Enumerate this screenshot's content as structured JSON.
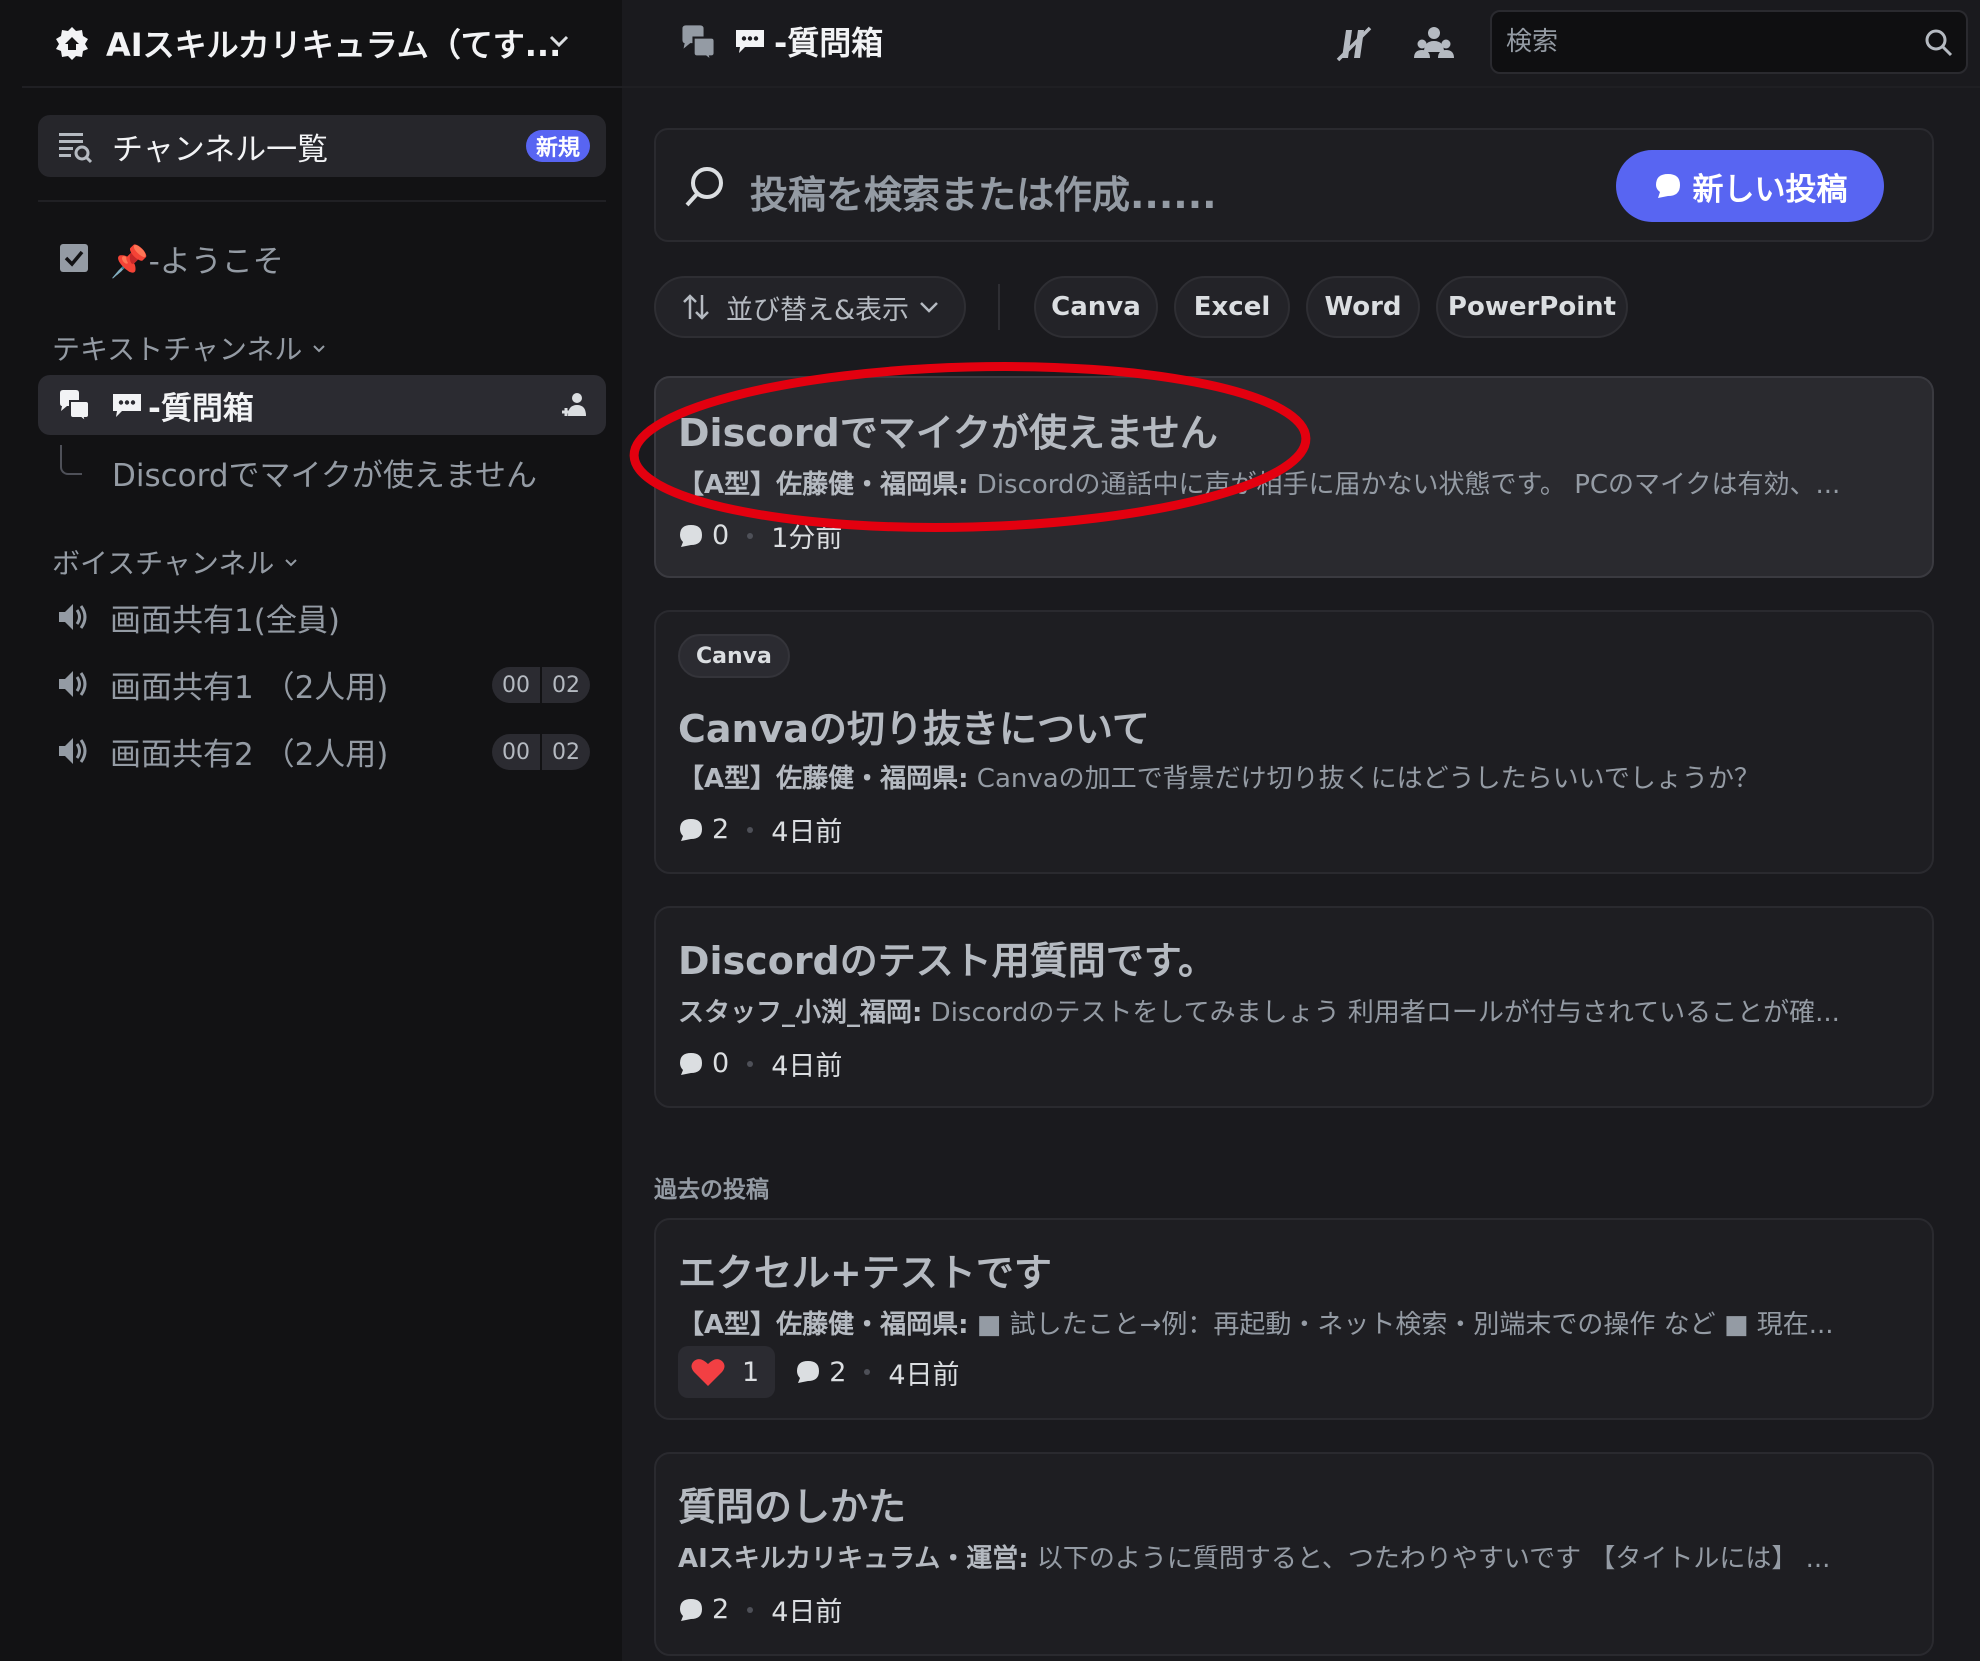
{
  "sidebar": {
    "server_name": "AIスキルカリキュラム（てす...",
    "channel_list": {
      "label": "チャンネル一覧",
      "badge": "新規"
    },
    "welcome": "📌-ようこそ",
    "text_category": "テキストチャンネル",
    "active_channel": "-質問箱",
    "thread": "Discordでマイクが使えません",
    "voice_category": "ボイスチャンネル",
    "voice_channels": [
      {
        "label": "画面共有1(全員)"
      },
      {
        "label": "画面共有1 （2人用)",
        "count_a": "00",
        "count_b": "02"
      },
      {
        "label": "画面共有2 （2人用)",
        "count_a": "00",
        "count_b": "02"
      }
    ]
  },
  "topbar": {
    "title": "-質問箱",
    "search_placeholder": "検索"
  },
  "postbar": {
    "placeholder": "投稿を検索または作成......",
    "new_post": "新しい投稿"
  },
  "filters": {
    "sort_label": "並び替え&表示",
    "tags": [
      "Canva",
      "Excel",
      "Word",
      "PowerPoint"
    ]
  },
  "posts": [
    {
      "title": "Discordでマイクが使えません",
      "author": "【A型】佐藤健・福岡県:",
      "snippet": " Discordの通話中に声が相手に届かない状態です。 PCのマイクは有効、...",
      "replies": "0",
      "time": "1分前"
    },
    {
      "tag": "Canva",
      "title": "Canvaの切り抜きについて",
      "author": "【A型】佐藤健・福岡県:",
      "snippet": " Canvaの加工で背景だけ切り抜くにはどうしたらいいでしょうか？",
      "replies": "2",
      "time": "4日前"
    },
    {
      "title": "Discordのテスト用質問です。",
      "author": "スタッフ_小渕_福岡:",
      "snippet": " Discordのテストをしてみましょう 利用者ロールが付与されていることが確...",
      "replies": "0",
      "time": "4日前"
    }
  ],
  "past_label": "過去の投稿",
  "past_posts": [
    {
      "title": "エクセル+テストです",
      "author": "【A型】佐藤健・福岡県:",
      "snippet": " ■ 試したこと→例：再起動・ネット検索・別端末での操作 など ■ 現在...",
      "reaction_count": "1",
      "replies": "2",
      "time": "4日前"
    },
    {
      "title": "質問のしかた",
      "author": "AIスキルカリキュラム・運営:",
      "snippet": " 以下のように質問すると、つたわりやすいです 【タイトルには】 ...",
      "replies": "2",
      "time": "4日前"
    }
  ],
  "colors": {
    "accent": "#5865f2",
    "annotation_circle": "#e3000f",
    "heart": "#f23f43",
    "pin": "#f04747"
  }
}
